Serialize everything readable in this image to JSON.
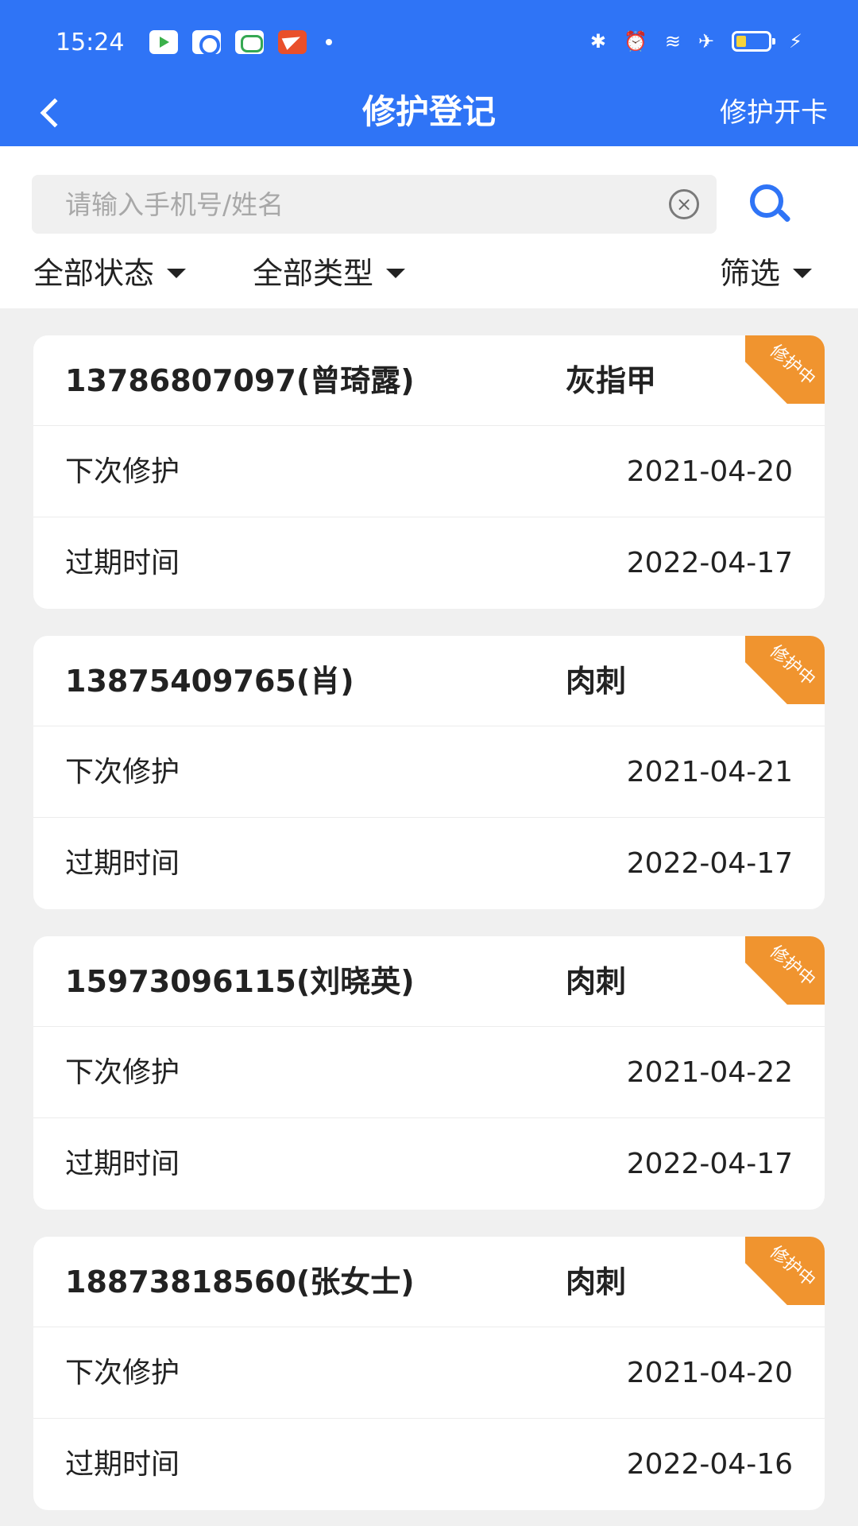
{
  "status_bar": {
    "time": "15:24",
    "apps": [
      "video-app-icon",
      "eye-app-icon",
      "chat-app-icon",
      "plane-app-icon"
    ],
    "right_icons": [
      "bluetooth-icon",
      "alarm-icon",
      "wifi-icon",
      "airplane-icon",
      "battery-icon",
      "charging-icon"
    ]
  },
  "header": {
    "title": "修护登记",
    "action_label": "修护开卡"
  },
  "search": {
    "placeholder": "请输入手机号/姓名",
    "value": ""
  },
  "filters": {
    "status_label": "全部状态",
    "type_label": "全部类型",
    "filter_label": "筛选"
  },
  "records": [
    {
      "contact": "13786807097(曾琦露)",
      "type": "灰指甲",
      "badge": "修护中",
      "next_label": "下次修护",
      "next_date": "2021-04-20",
      "expire_label": "过期时间",
      "expire_date": "2022-04-17"
    },
    {
      "contact": "13875409765(肖)",
      "type": "肉刺",
      "badge": "修护中",
      "next_label": "下次修护",
      "next_date": "2021-04-21",
      "expire_label": "过期时间",
      "expire_date": "2022-04-17"
    },
    {
      "contact": "15973096115(刘晓英)",
      "type": "肉刺",
      "badge": "修护中",
      "next_label": "下次修护",
      "next_date": "2021-04-22",
      "expire_label": "过期时间",
      "expire_date": "2022-04-17"
    },
    {
      "contact": "18873818560(张女士)",
      "type": "肉刺",
      "badge": "修护中",
      "next_label": "下次修护",
      "next_date": "2021-04-20",
      "expire_label": "过期时间",
      "expire_date": "2022-04-16"
    }
  ],
  "colors": {
    "brand_blue": "#2f74f6",
    "badge_orange": "#f0942f",
    "page_background": "#f0f0f0"
  }
}
